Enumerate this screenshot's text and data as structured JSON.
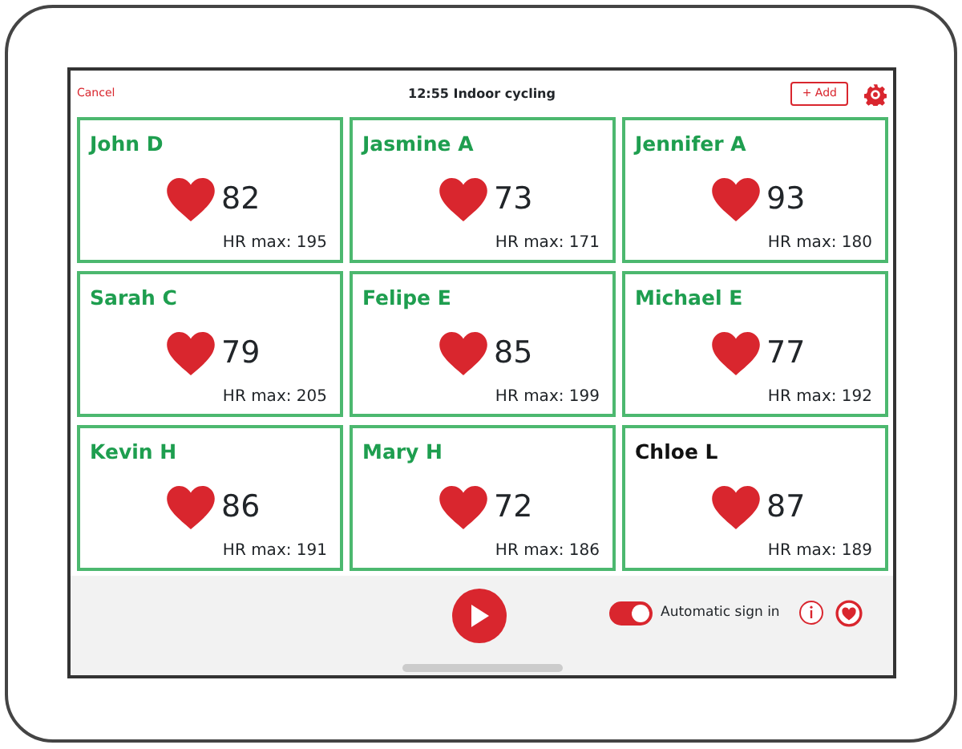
{
  "header": {
    "cancel": "Cancel",
    "title": "12:55 Indoor cycling",
    "add_icon": "+",
    "add": "Add"
  },
  "riders": [
    {
      "name": "John D",
      "color": "#1e9e4f",
      "bpm": "82",
      "hr_max": "HR max: 195"
    },
    {
      "name": "Jasmine A",
      "color": "#1e9e4f",
      "bpm": "73",
      "hr_max": "HR max: 171"
    },
    {
      "name": "Jennifer A",
      "color": "#1e9e4f",
      "bpm": "93",
      "hr_max": "HR max: 180"
    },
    {
      "name": "Sarah C",
      "color": "#1e9e4f",
      "bpm": "79",
      "hr_max": "HR max: 205"
    },
    {
      "name": "Felipe E",
      "color": "#1e9e4f",
      "bpm": "85",
      "hr_max": "HR max: 199"
    },
    {
      "name": "Michael E",
      "color": "#1e9e4f",
      "bpm": "77",
      "hr_max": "HR max: 192"
    },
    {
      "name": "Kevin H",
      "color": "#1e9e4f",
      "bpm": "86",
      "hr_max": "HR max: 191"
    },
    {
      "name": "Mary H",
      "color": "#1e9e4f",
      "bpm": "72",
      "hr_max": "HR max: 186"
    },
    {
      "name": "Chloe L",
      "color": "#111111",
      "bpm": "87",
      "hr_max": "HR max: 189"
    }
  ],
  "footer": {
    "auto_sign_in": {
      "label": "Automatic sign in",
      "on": true
    }
  }
}
